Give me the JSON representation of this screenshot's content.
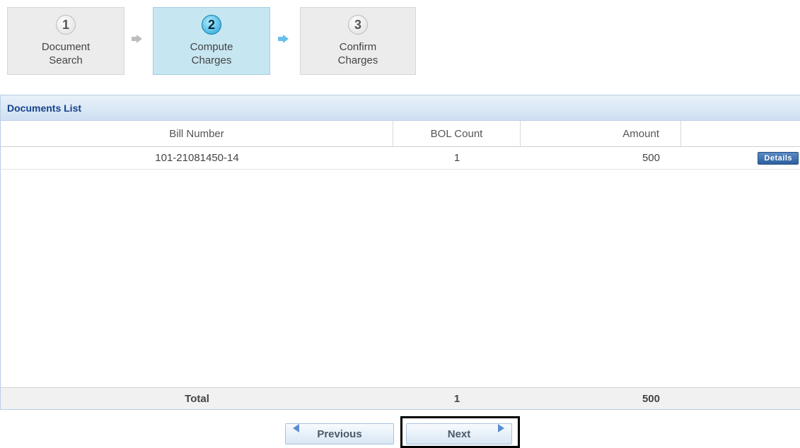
{
  "wizard": {
    "steps": [
      {
        "number": "1",
        "line1": "Document",
        "line2": "Search",
        "state": "inactive"
      },
      {
        "number": "2",
        "line1": "Compute",
        "line2": "Charges",
        "state": "active"
      },
      {
        "number": "3",
        "line1": "Confirm",
        "line2": "Charges",
        "state": "inactive"
      }
    ]
  },
  "documents": {
    "title": "Documents List",
    "columns": [
      "Bill Number",
      "BOL Count",
      "Amount"
    ],
    "rows": [
      {
        "bill_number": "101-21081450-14",
        "bol_count": "1",
        "amount": "500",
        "action": "Details"
      }
    ],
    "total": {
      "label": "Total",
      "bol_count": "1",
      "amount": "500"
    }
  },
  "nav": {
    "previous": "Previous",
    "next": "Next"
  },
  "colors": {
    "active_step": "#c6e6f1",
    "header_text": "#15428b",
    "details_button": "#2e5f9e"
  }
}
